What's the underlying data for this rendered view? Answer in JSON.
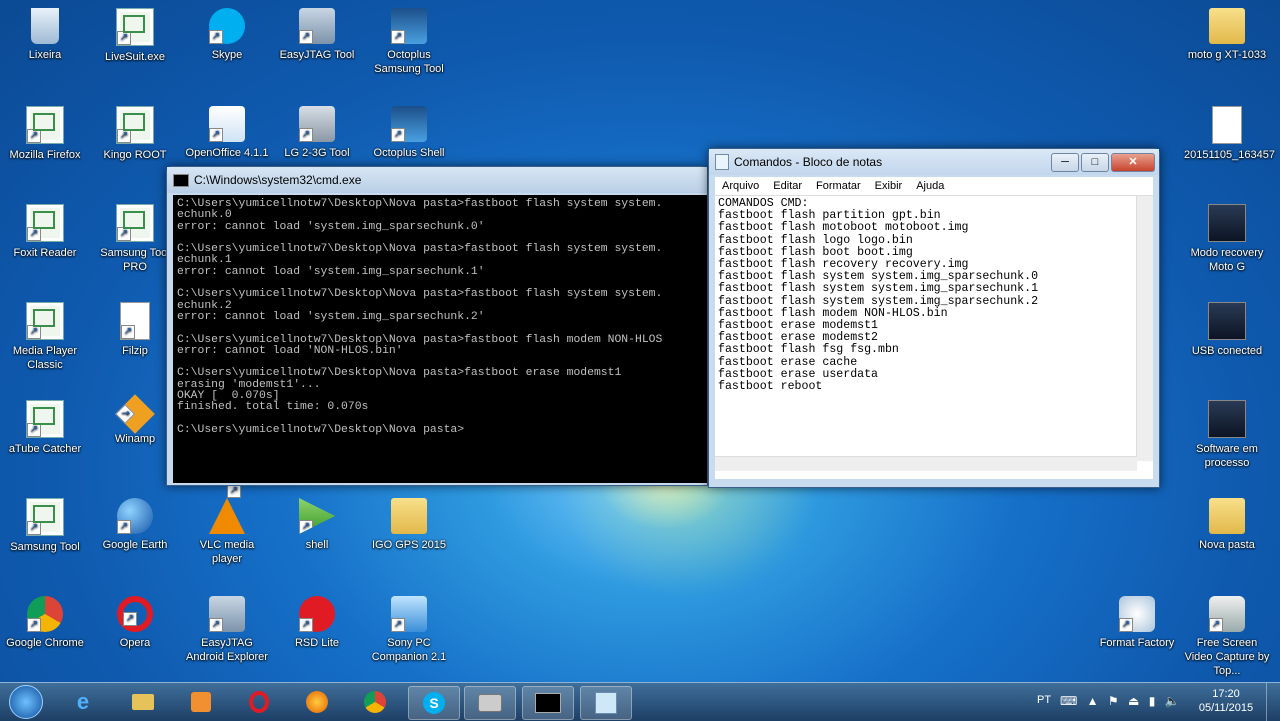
{
  "desktop": {
    "left_icons": [
      {
        "label": "Lixeira",
        "icon": "recycle-bin-icon"
      },
      {
        "label": "LiveSuit.exe",
        "icon": "app-icon"
      },
      {
        "label": "Skype",
        "icon": "skype-icon"
      },
      {
        "label": "EasyJTAG Tool",
        "icon": "easyjtag-icon"
      },
      {
        "label": "Octoplus Samsung Tool",
        "icon": "octoplus-icon"
      },
      {
        "label": "Mozilla Firefox",
        "icon": "app-icon"
      },
      {
        "label": "Kingo ROOT",
        "icon": "app-icon"
      },
      {
        "label": "OpenOffice 4.1.1",
        "icon": "openoffice-icon"
      },
      {
        "label": "LG 2-3G Tool",
        "icon": "lg-tool-icon"
      },
      {
        "label": "Octoplus Shell",
        "icon": "octoplus-icon"
      },
      {
        "label": "Foxit Reader",
        "icon": "app-icon"
      },
      {
        "label": "Samsung Tool PRO",
        "icon": "app-icon"
      },
      {
        "label": "Media Player Classic",
        "icon": "app-icon"
      },
      {
        "label": "Filzip",
        "icon": "file-icon"
      },
      {
        "label": "aTube Catcher",
        "icon": "app-icon"
      },
      {
        "label": "Winamp",
        "icon": "winamp-icon"
      },
      {
        "label": "Samsung Tool",
        "icon": "app-icon"
      },
      {
        "label": "Google Earth",
        "icon": "google-earth-icon"
      },
      {
        "label": "VLC media player",
        "icon": "vlc-icon"
      },
      {
        "label": "shell",
        "icon": "shell-icon"
      },
      {
        "label": "IGO GPS 2015",
        "icon": "folder-icon"
      },
      {
        "label": "Google Chrome",
        "icon": "chrome-icon"
      },
      {
        "label": "Opera",
        "icon": "opera-icon"
      },
      {
        "label": "EasyJTAG Android Explorer",
        "icon": "easyjtag-icon"
      },
      {
        "label": "RSD Lite",
        "icon": "motorola-icon"
      },
      {
        "label": "Sony PC Companion 2.1",
        "icon": "sony-icon"
      }
    ],
    "right_icons": [
      {
        "label": "moto g XT-1033",
        "icon": "folder-icon"
      },
      {
        "label": "20151105_163457",
        "icon": "audio-file-icon"
      },
      {
        "label": "Modo recovery Moto G",
        "icon": "image-icon"
      },
      {
        "label": "USB conected",
        "icon": "image-icon"
      },
      {
        "label": "Software em processo",
        "icon": "image-icon"
      },
      {
        "label": "Nova pasta",
        "icon": "folder-icon"
      },
      {
        "label": "Format Factory",
        "icon": "format-factory-icon"
      },
      {
        "label": "Free Screen Video Capture by Top...",
        "icon": "camera-icon"
      }
    ]
  },
  "cmd_window": {
    "title": "C:\\Windows\\system32\\cmd.exe",
    "lines": [
      "C:\\Users\\yumicellnotw7\\Desktop\\Nova pasta>fastboot flash system system.",
      "echunk.0",
      "error: cannot load 'system.img_sparsechunk.0'",
      "",
      "C:\\Users\\yumicellnotw7\\Desktop\\Nova pasta>fastboot flash system system.",
      "echunk.1",
      "error: cannot load 'system.img_sparsechunk.1'",
      "",
      "C:\\Users\\yumicellnotw7\\Desktop\\Nova pasta>fastboot flash system system.",
      "echunk.2",
      "error: cannot load 'system.img_sparsechunk.2'",
      "",
      "C:\\Users\\yumicellnotw7\\Desktop\\Nova pasta>fastboot flash modem NON-HLOS",
      "error: cannot load 'NON-HLOS.bin'",
      "",
      "C:\\Users\\yumicellnotw7\\Desktop\\Nova pasta>fastboot erase modemst1",
      "erasing 'modemst1'...",
      "OKAY [  0.070s]",
      "finished. total time: 0.070s",
      "",
      "C:\\Users\\yumicellnotw7\\Desktop\\Nova pasta>"
    ]
  },
  "notepad": {
    "title": "Comandos - Bloco de notas",
    "menu": [
      "Arquivo",
      "Editar",
      "Formatar",
      "Exibir",
      "Ajuda"
    ],
    "lines": [
      "COMANDOS CMD:",
      "fastboot flash partition gpt.bin",
      "fastboot flash motoboot motoboot.img",
      "fastboot flash logo logo.bin",
      "fastboot flash boot boot.img",
      "fastboot flash recovery recovery.img",
      "fastboot flash system system.img_sparsechunk.0",
      "fastboot flash system system.img_sparsechunk.1",
      "fastboot flash system system.img_sparsechunk.2",
      "fastboot flash modem NON-HLOS.bin",
      "fastboot erase modemst1",
      "fastboot erase modemst2",
      "fastboot flash fsg fsg.mbn",
      "fastboot erase cache",
      "fastboot erase userdata",
      "fastboot reboot"
    ]
  },
  "taskbar": {
    "buttons": [
      "start-orb",
      "internet-explorer-icon",
      "explorer-icon",
      "media-player-icon",
      "opera-icon",
      "firefox-icon",
      "chrome-icon",
      "skype-icon",
      "camera-icon",
      "cmd-icon",
      "notepad-icon"
    ],
    "language": "PT",
    "time": "17:20",
    "date": "05/11/2015"
  },
  "window_controls": {
    "minimize": "─",
    "maximize": "□",
    "close": "✕"
  }
}
